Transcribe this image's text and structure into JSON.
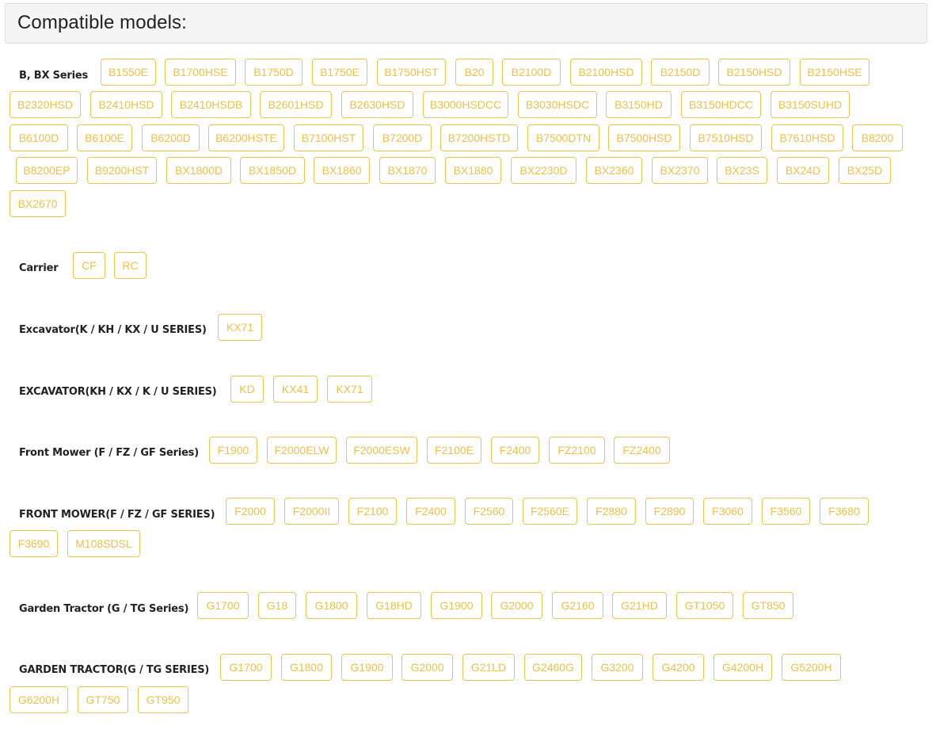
{
  "title": "Compatible models:",
  "groups": [
    {
      "label": "B, BX Series",
      "models": [
        "B1550E",
        "B1700HSE",
        "B1750D",
        "B1750E",
        "B1750HST",
        "B20",
        "B2100D",
        "B2100HSD",
        "B2150D",
        "B2150HSD",
        "B2150HSE",
        "B2320HSD",
        "B2410HSD",
        "B2410HSDB",
        "B2601HSD",
        "B2630HSD",
        "B3000HSDCC",
        "B3030HSDC",
        "B3150HD",
        "B3150HDCC",
        "B3150SUHD",
        "B6100D",
        "B6100E",
        "B6200D",
        "B6200HSTE",
        "B7100HST",
        "B7200D",
        "B7200HSTD",
        "B7500DTN",
        "B7500HSD",
        "B7510HSD",
        "B7610HSD",
        "B8200",
        "B8200EP",
        "B9200HST",
        "BX1800D",
        "BX1850D",
        "BX1860",
        "BX1870",
        "BX1880",
        "BX2230D",
        "BX2360",
        "BX2370",
        "BX23S",
        "BX24D",
        "BX25D",
        "BX2670"
      ]
    },
    {
      "label": "Carrier",
      "models": [
        "CF",
        "RC"
      ]
    },
    {
      "label": "Excavator(K / KH / KX / U SERIES)",
      "models": [
        "KX71"
      ]
    },
    {
      "label": "EXCAVATOR(KH / KX / K / U SERIES)",
      "models": [
        "KD",
        "KX41",
        "KX71"
      ]
    },
    {
      "label": "Front Mower (F / FZ / GF Series)",
      "models": [
        "F1900",
        "F2000ELW",
        "F2000ESW",
        "F2100E",
        "F2400",
        "FZ2100",
        "FZ2400"
      ]
    },
    {
      "label": "FRONT MOWER(F / FZ / GF SERIES)",
      "models": [
        "F2000",
        "F2000II",
        "F2100",
        "F2400",
        "F2560",
        "F2560E",
        "F2880",
        "F2890",
        "F3060",
        "F3560",
        "F3680",
        "F3690",
        "M108SDSL"
      ]
    },
    {
      "label": "Garden Tractor (G / TG Series)",
      "models": [
        "G1700",
        "G18",
        "G1800",
        "G18HD",
        "G1900",
        "G2000",
        "G2160",
        "G21HD",
        "GT1050",
        "GT850"
      ]
    },
    {
      "label": "GARDEN TRACTOR(G / TG SERIES)",
      "models": [
        "G1700",
        "G1800",
        "G1900",
        "G2000",
        "G21LD",
        "G2460G",
        "G3200",
        "G4200",
        "G4200H",
        "G5200H",
        "G6200H",
        "GT750",
        "GT950"
      ]
    }
  ],
  "colors": {
    "tag_border": "#f0c44c",
    "tag_text": "#efc14a",
    "header_bg": "#f5f5f5"
  }
}
